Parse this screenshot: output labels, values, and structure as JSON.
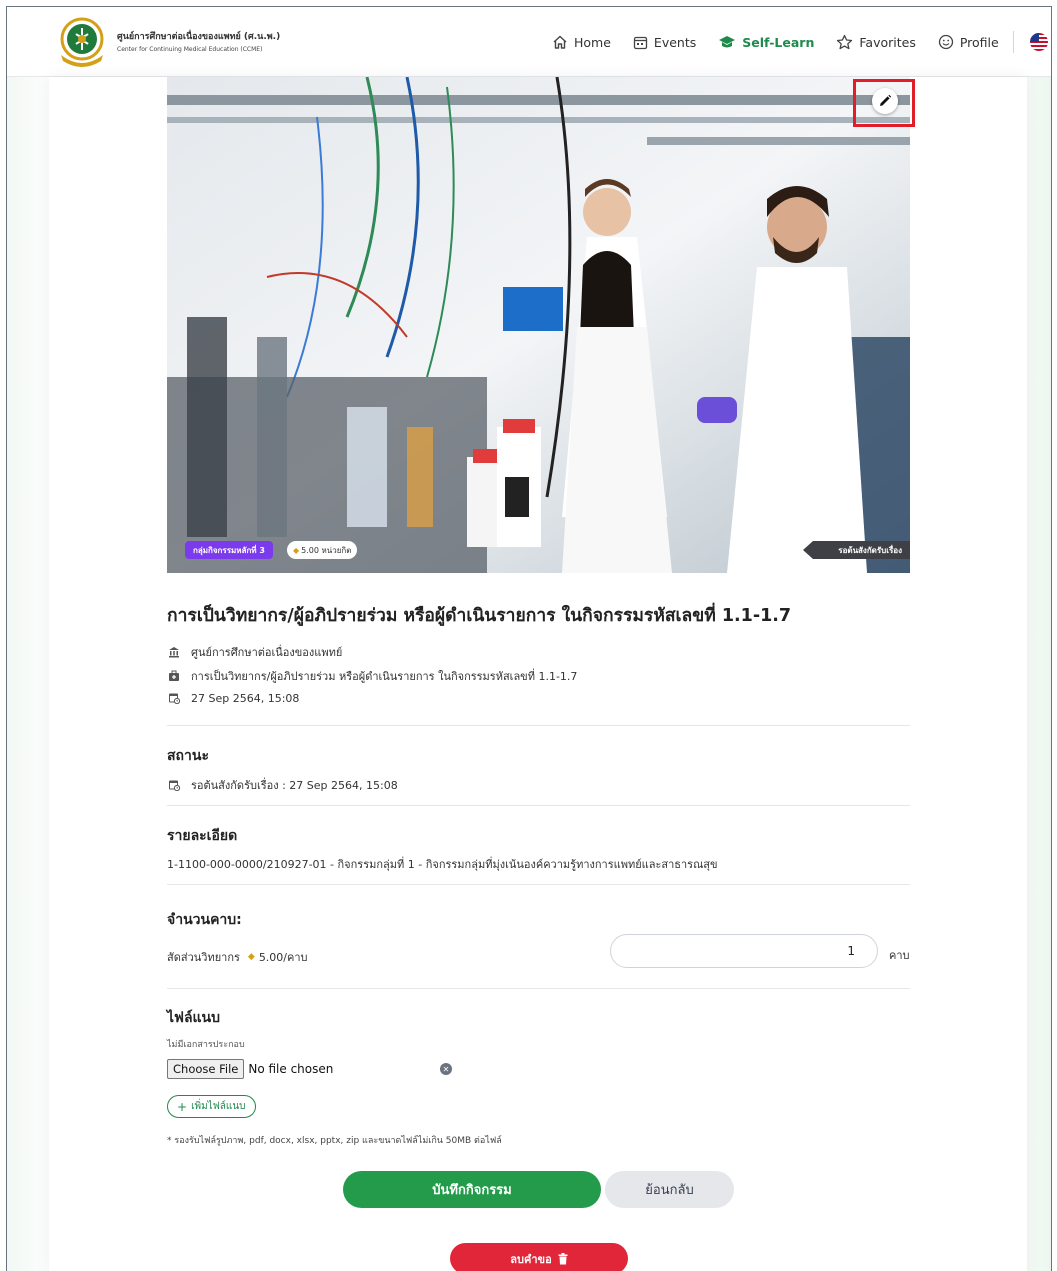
{
  "brand": {
    "name_th": "ศูนย์การศึกษาต่อเนื่องของแพทย์ (ศ.น.พ.)",
    "name_en": "Center for Continuing Medical Education (CCME)"
  },
  "nav": {
    "items": [
      {
        "label": "Home",
        "icon": "home-icon",
        "active": false
      },
      {
        "label": "Events",
        "icon": "calendar-icon",
        "active": false
      },
      {
        "label": "Self-Learn",
        "icon": "graduation-cap-icon",
        "active": true
      },
      {
        "label": "Favorites",
        "icon": "star-icon",
        "active": false
      },
      {
        "label": "Profile",
        "icon": "smiley-icon",
        "active": false
      }
    ],
    "language_flag": "us-flag-icon"
  },
  "hero": {
    "tag_group": "กลุ่มกิจกรรมหลักที่ 3",
    "tag_credit": "5.00 หน่วยกิต",
    "tag_status": "รอต้นสังกัดรับเรื่อง",
    "edit_icon": "pencil-icon"
  },
  "activity": {
    "title": "การเป็นวิทยากร/ผู้อภิปรายร่วม หรือผู้ดำเนินรายการ ในกิจกรรมรหัสเลขที่ 1.1-1.7",
    "organizer": "ศูนย์การศึกษาต่อเนื่องของแพทย์",
    "category": "การเป็นวิทยากร/ผู้อภิปรายร่วม หรือผู้ดำเนินรายการ ในกิจกรรมรหัสเลขที่ 1.1-1.7",
    "date": "27 Sep 2564, 15:08"
  },
  "status": {
    "heading": "สถานะ",
    "text": "รอต้นสังกัดรับเรื่อง : 27 Sep 2564, 15:08"
  },
  "details": {
    "heading": "รายละเอียด",
    "text": "1-1100-000-0000/210927-01 - กิจกรรมกลุ่มที่ 1 - กิจกรรมกลุ่มที่มุ่งเน้นองค์ความรู้ทางการแพทย์และสาธารณสุข"
  },
  "periods": {
    "heading": "จำนวนคาบ:",
    "ratio_label": "สัดส่วนวิทยากร",
    "ratio_value": "5.00/คาบ",
    "quantity": "1",
    "unit": "คาบ"
  },
  "attachments": {
    "heading": "ไฟล์แนบ",
    "no_doc": "ไม่มีเอกสารประกอบ",
    "choose_file": "Choose File",
    "no_file": "No file chosen",
    "add_file": "เพิ่มไฟล์แนบ",
    "note": "* รองรับไฟล์รูปภาพ, pdf, docx, xlsx, pptx, zip และขนาดไฟล์ไม่เกิน 50MB ต่อไฟล์"
  },
  "actions": {
    "save": "บันทึกกิจกรรม",
    "back": "ย้อนกลับ",
    "delete": "ลบคำขอ"
  },
  "colors": {
    "primary_green": "#239b4a",
    "delete_red": "#e2263a",
    "purple_tag": "#7c3aed",
    "highlight_red": "#e11d2a"
  }
}
